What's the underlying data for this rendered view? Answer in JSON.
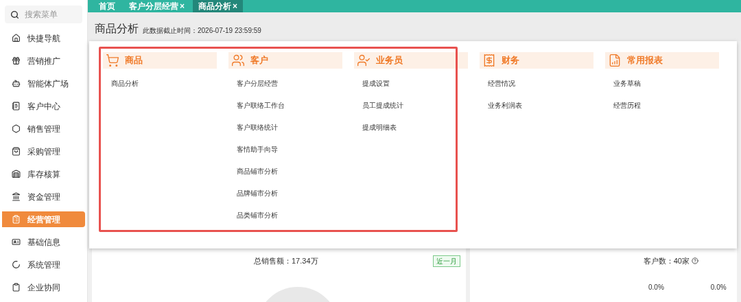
{
  "tabs": [
    {
      "label": "首页",
      "closable": false,
      "selected": false
    },
    {
      "label": "客户分层经营",
      "closable": true,
      "selected": false
    },
    {
      "label": "商品分析",
      "closable": true,
      "selected": true
    }
  ],
  "close_glyph": "×",
  "sidebar": {
    "search": {
      "placeholder": "搜索菜单"
    },
    "items": [
      {
        "label": "快捷导航",
        "selected": false
      },
      {
        "label": "营销推广",
        "selected": false
      },
      {
        "label": "智能体广场",
        "selected": false
      },
      {
        "label": "客户中心",
        "selected": false
      },
      {
        "label": "销售管理",
        "selected": false
      },
      {
        "label": "采购管理",
        "selected": false
      },
      {
        "label": "库存核算",
        "selected": false
      },
      {
        "label": "资金管理",
        "selected": false
      },
      {
        "label": "经营管理",
        "selected": true
      },
      {
        "label": "基础信息",
        "selected": false
      },
      {
        "label": "系统管理",
        "selected": false
      },
      {
        "label": "企业协同",
        "selected": false
      }
    ]
  },
  "page": {
    "title": "商品分析",
    "data_cutoff": "此数据截止时间：2026-07-19 23:59:59"
  },
  "menu": {
    "groups": [
      {
        "title": "商品",
        "items": [
          "商品分析"
        ]
      },
      {
        "title": "客户",
        "items": [
          "客户分层经营",
          "客户联络工作台",
          "客户联络统计",
          "客情助手向导",
          "商品铺市分析",
          "品牌铺市分析",
          "品类铺市分析"
        ]
      },
      {
        "title": "业务员",
        "items": [
          "提成设置",
          "员工提成统计",
          "提成明细表"
        ]
      },
      {
        "title": "财务",
        "items": [
          "经营情况",
          "业务利润表"
        ]
      },
      {
        "title": "常用报表",
        "items": [
          "业务草稿",
          "经营历程"
        ]
      }
    ]
  },
  "cards": {
    "sales": {
      "label": "总销售额：17.34万",
      "period": "近一月"
    },
    "customers": {
      "label": "客户数：40家",
      "values": [
        "0.0%",
        "0.0%"
      ]
    }
  }
}
